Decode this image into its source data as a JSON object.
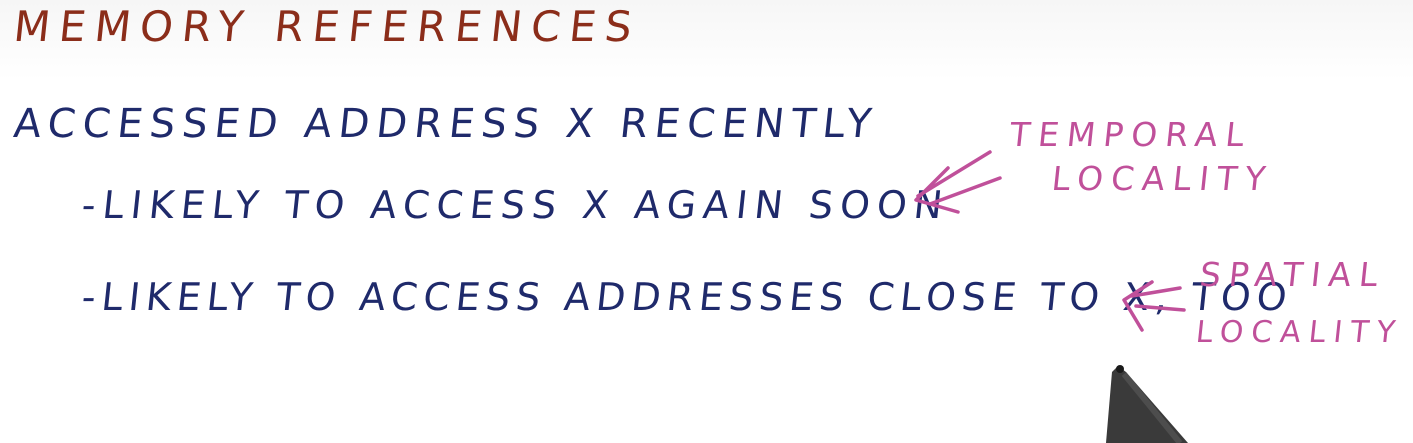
{
  "colors": {
    "title": "#8b2d1a",
    "ink": "#1f2a6b",
    "note": "#c0509a",
    "pen": "#3a3a3a"
  },
  "board": {
    "title": "MEMORY REFERENCES",
    "line1": "ACCESSED ADDRESS X RECENTLY",
    "line2": "-LIKELY TO ACCESS X AGAIN SOON",
    "line3": "-LIKELY TO ACCESS ADDRESSES CLOSE TO X, TOO"
  },
  "annotations": {
    "temporal": {
      "line1": "TEMPORAL",
      "line2": "LOCALITY"
    },
    "spatial": {
      "line1": "SPATIAL",
      "line2": "LOCALITY"
    }
  },
  "icons": {
    "arrow": "left-arrow-icon",
    "pen": "pen-tip-icon"
  }
}
